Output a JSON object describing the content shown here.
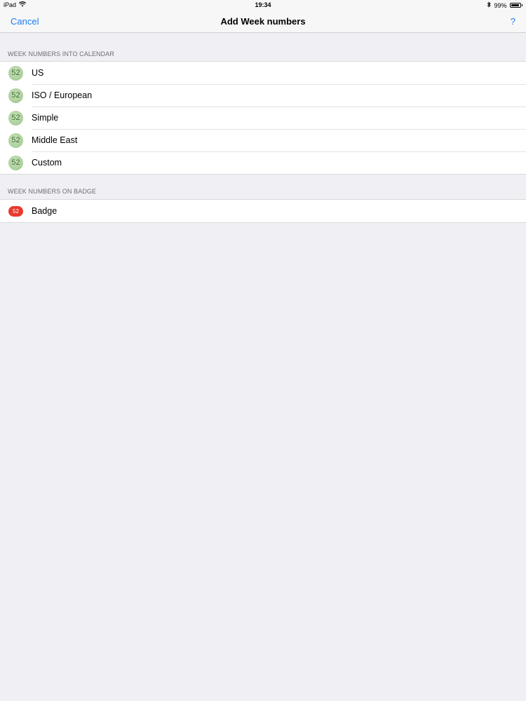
{
  "status_bar": {
    "device": "iPad",
    "time": "19:34",
    "battery": "99%",
    "battery_level": 0.99,
    "icons": [
      "wifi-icon",
      "bluetooth-icon",
      "battery-icon"
    ]
  },
  "nav": {
    "cancel_label": "Cancel",
    "title": "Add Week numbers",
    "help_label": "?"
  },
  "sections": {
    "calendar": {
      "header": "WEEK NUMBERS INTO CALENDAR",
      "items": [
        {
          "icon_text": "52",
          "label": "US"
        },
        {
          "icon_text": "52",
          "label": "ISO / European"
        },
        {
          "icon_text": "52",
          "label": "Simple"
        },
        {
          "icon_text": "52",
          "label": "Middle East"
        },
        {
          "icon_text": "52",
          "label": "Custom"
        }
      ]
    },
    "badge": {
      "header": "WEEK NUMBERS ON BADGE",
      "items": [
        {
          "icon_text": "52",
          "label": "Badge"
        }
      ]
    }
  },
  "colors": {
    "accent": "#1a7cf5",
    "background": "#efeff4",
    "week_icon_green": "#a9cd98",
    "badge_red": "#e8392f"
  }
}
